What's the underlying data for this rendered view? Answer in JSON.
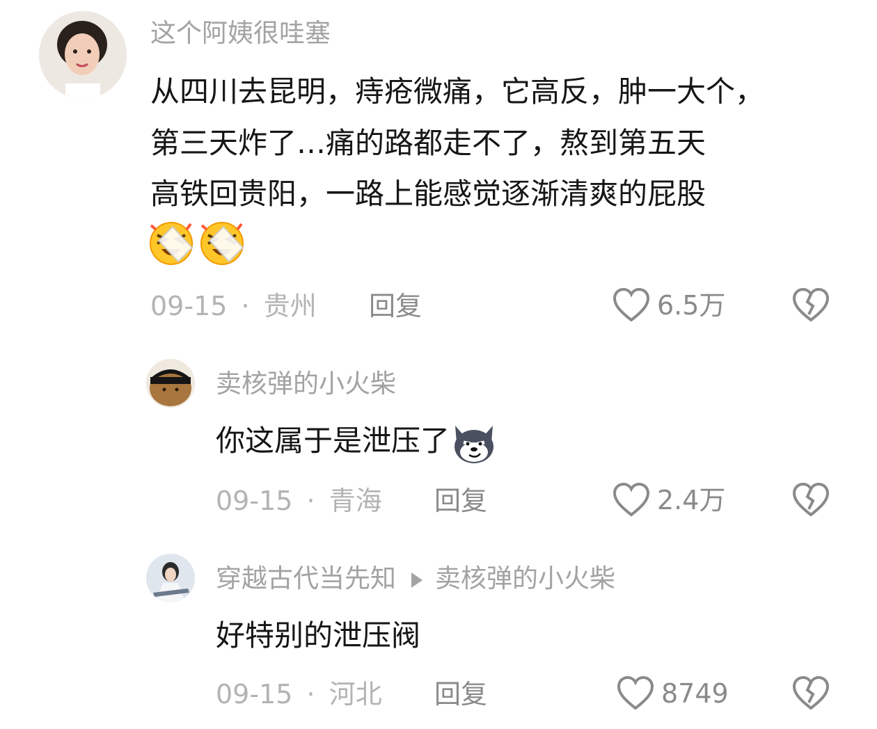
{
  "comments": [
    {
      "username": "这个阿姨很哇塞",
      "lines": [
        "从四川去昆明，痔疮微痛，它高反，肿一大个，",
        "第三天炸了…痛的路都走不了，熬到第五天",
        "高铁回贵阳，一路上能感觉逐渐清爽的屁股"
      ],
      "emojis": [
        "laughing-crying-emoji",
        "laughing-crying-emoji"
      ],
      "date": "09-15",
      "location": "贵州",
      "reply_label": "回复",
      "like_count": "6.5万"
    },
    {
      "username": "卖核弹的小火柴",
      "text": "你这属于是泄压了",
      "emoji": "husky-smirk-emoji",
      "date": "09-15",
      "location": "青海",
      "reply_label": "回复",
      "like_count": "2.4万"
    },
    {
      "username": "穿越古代当先知",
      "reply_to": "卖核弹的小火柴",
      "text": "好特别的泄压阀",
      "date": "09-15",
      "location": "河北",
      "reply_label": "回复",
      "like_count": "8749"
    }
  ],
  "separator": "·",
  "colors": {
    "text": "#161616",
    "muted": "#a3a3a3",
    "action": "#8a8a8a",
    "background": "#ffffff"
  }
}
